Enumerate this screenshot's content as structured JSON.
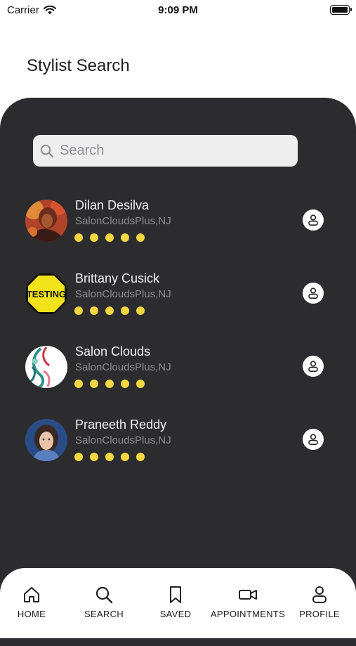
{
  "status_bar": {
    "carrier": "Carrier",
    "time": "9:09 PM"
  },
  "header": {
    "title": "Stylist Search"
  },
  "search": {
    "placeholder": "Search"
  },
  "stylists": [
    {
      "name": "Dilan Desilva",
      "salon": "SalonCloudsPlus,NJ",
      "rating": 5
    },
    {
      "name": "Brittany Cusick",
      "salon": "SalonCloudsPlus,NJ",
      "rating": 5,
      "avatar_text": "TESTING"
    },
    {
      "name": "Salon Clouds",
      "salon": "SalonCloudsPlus,NJ",
      "rating": 5
    },
    {
      "name": "Praneeth Reddy",
      "salon": "SalonCloudsPlus,NJ",
      "rating": 5
    }
  ],
  "tabs": [
    {
      "label": "HOME"
    },
    {
      "label": "SEARCH"
    },
    {
      "label": "SAVED"
    },
    {
      "label": "APPOINTMENTS"
    },
    {
      "label": "PROFILE"
    }
  ],
  "colors": {
    "panel": "#2c2c2e",
    "rating_dot": "#f5d743",
    "background": "#ffffff"
  }
}
